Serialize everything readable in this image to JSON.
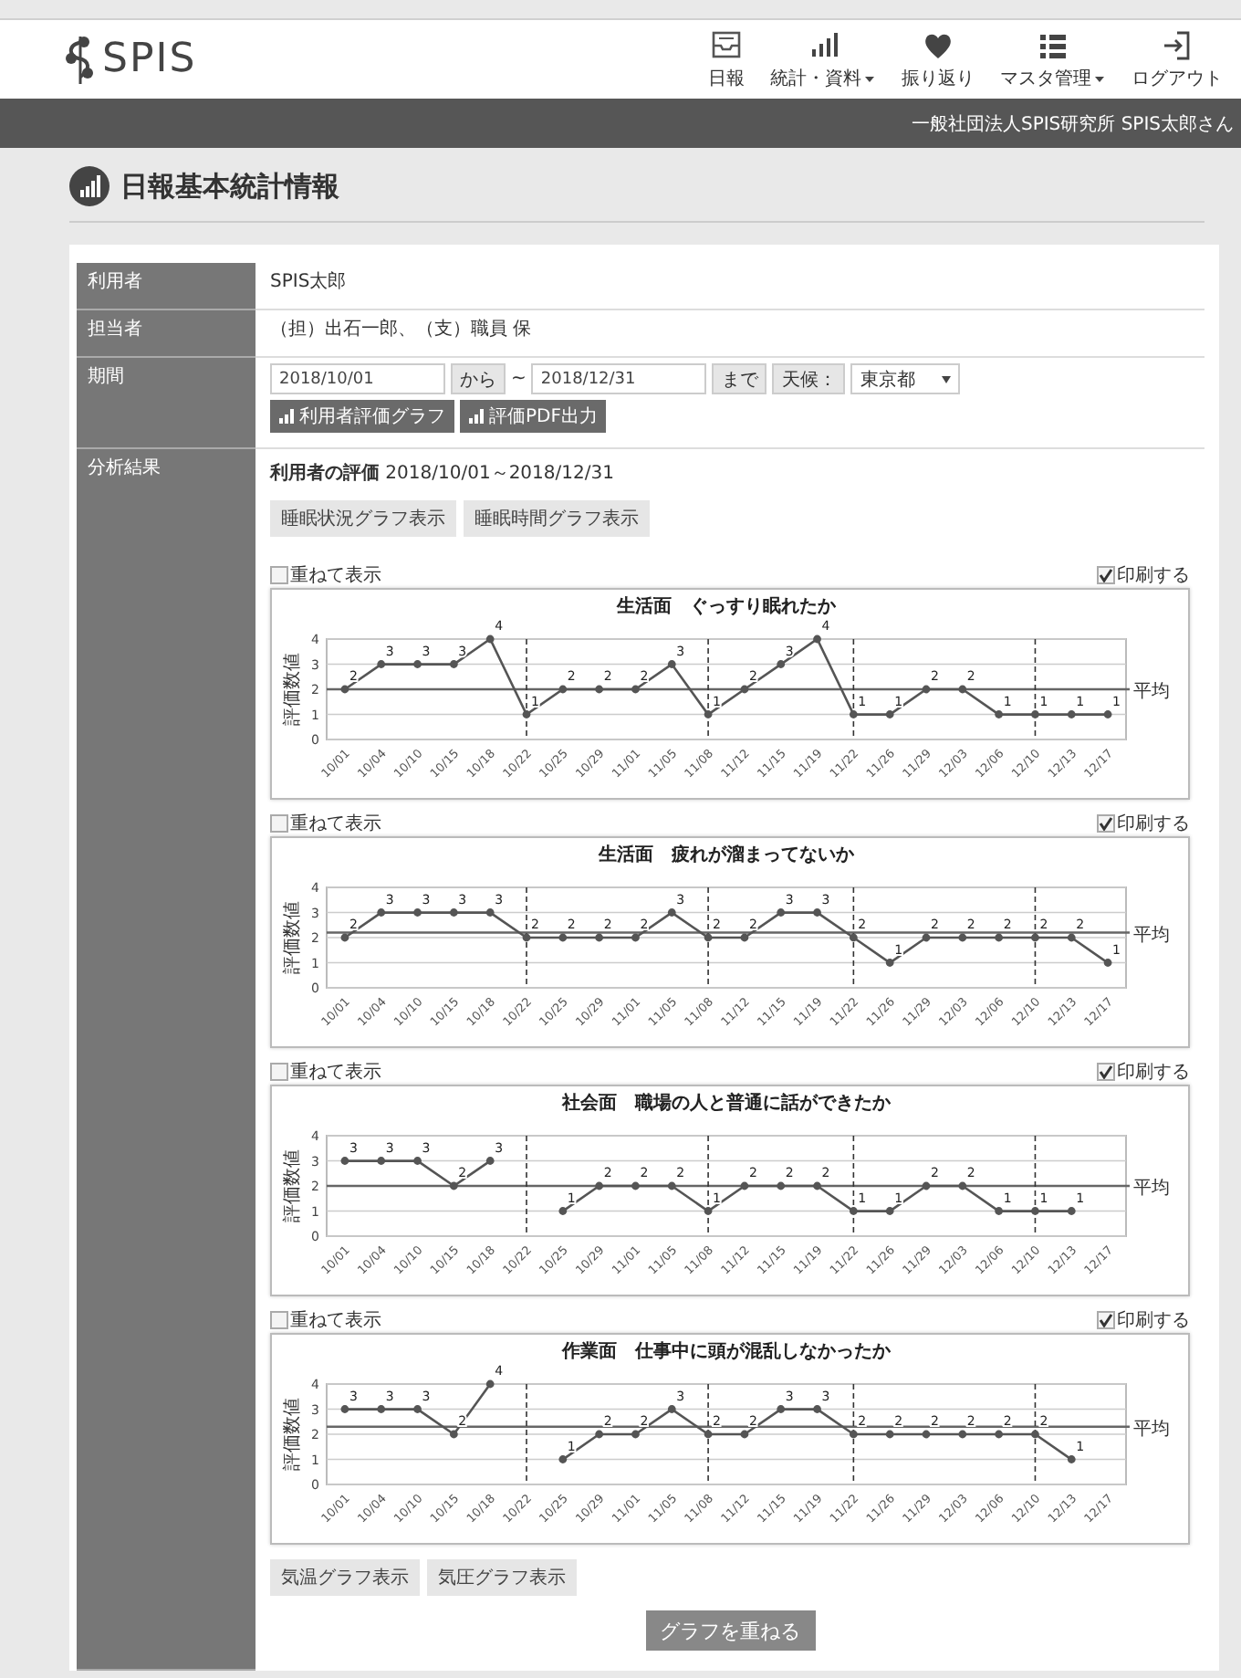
{
  "header": {
    "logo": "SPIS",
    "nav": [
      {
        "label": "日報",
        "has_menu": false
      },
      {
        "label": "統計・資料",
        "has_menu": true
      },
      {
        "label": "振り返り",
        "has_menu": false
      },
      {
        "label": "マスタ管理",
        "has_menu": true
      },
      {
        "label": "ログアウト",
        "has_menu": false
      }
    ]
  },
  "account_bar": {
    "text": "一般社団法人SPIS研究所 SPIS太郎さん"
  },
  "page_title": "日報基本統計情報",
  "info": {
    "user": {
      "label": "利用者",
      "value": "SPIS太郎"
    },
    "staff": {
      "label": "担当者",
      "value": "（担）出石一郎、（支）職員 保"
    },
    "period": {
      "label": "期間",
      "from": "2018/10/01",
      "from_suffix": "から",
      "separator": "~",
      "to": "2018/12/31",
      "to_suffix": "まで",
      "weather_label": "天候：",
      "weather_value": "東京都",
      "buttons": [
        "利用者評価グラフ",
        "評価PDF出力"
      ]
    }
  },
  "results": {
    "label": "分析結果",
    "heading": "**利用者の評価** 2018/10/01～2018/12/31",
    "sleep_buttons": [
      "睡眠状況グラフ表示",
      "睡眠時間グラフ表示"
    ],
    "charts": [
      {
        "overlay": {
          "label": "重ねて表示",
          "checked": false
        },
        "print": {
          "label": "印刷する",
          "checked": true
        },
        "chart_data": {
          "type": "line",
          "title": "生活面　ぐっすり眠れたか",
          "ylabel": "評価数値",
          "categories": [
            "10/01",
            "10/04",
            "10/10",
            "10/15",
            "10/18",
            "10/22",
            "10/25",
            "10/29",
            "11/01",
            "11/05",
            "11/08",
            "11/12",
            "11/15",
            "11/19",
            "11/22",
            "11/26",
            "11/29",
            "12/03",
            "12/06",
            "12/10",
            "12/13",
            "12/17"
          ],
          "series": [
            {
              "color": "#555555",
              "marker": "o",
              "values": [
                2,
                3,
                3,
                3,
                4,
                1,
                2,
                2,
                2,
                3,
                1,
                2,
                3,
                4,
                1,
                1,
                2,
                2,
                1,
                1,
                1,
                1
              ]
            }
          ],
          "ylim": [
            0,
            4
          ],
          "yticks": [
            0,
            1,
            2,
            3,
            4
          ],
          "grid": true,
          "data_labels": true,
          "ref_lines": [
            {
              "axis": "y",
              "value": 2.0,
              "label": "平均"
            },
            {
              "axis": "x",
              "value": "10/22"
            },
            {
              "axis": "x",
              "value": "11/08"
            },
            {
              "axis": "x",
              "value": "11/22"
            },
            {
              "axis": "x",
              "value": "12/10"
            }
          ]
        }
      },
      {
        "overlay": {
          "label": "重ねて表示",
          "checked": false
        },
        "print": {
          "label": "印刷する",
          "checked": true
        },
        "chart_data": {
          "type": "line",
          "title": "生活面　疲れが溜まってないか",
          "ylabel": "評価数値",
          "categories": [
            "10/01",
            "10/04",
            "10/10",
            "10/15",
            "10/18",
            "10/22",
            "10/25",
            "10/29",
            "11/01",
            "11/05",
            "11/08",
            "11/12",
            "11/15",
            "11/19",
            "11/22",
            "11/26",
            "11/29",
            "12/03",
            "12/06",
            "12/10",
            "12/13",
            "12/17"
          ],
          "series": [
            {
              "color": "#555555",
              "marker": "o",
              "values": [
                2,
                3,
                3,
                3,
                3,
                2,
                2,
                2,
                2,
                3,
                2,
                2,
                3,
                3,
                2,
                1,
                2,
                2,
                2,
                2,
                2,
                1
              ]
            }
          ],
          "ylim": [
            0,
            4
          ],
          "yticks": [
            0,
            1,
            2,
            3,
            4
          ],
          "grid": true,
          "data_labels": true,
          "ref_lines": [
            {
              "axis": "y",
              "value": 2.2,
              "label": "平均"
            },
            {
              "axis": "x",
              "value": "10/22"
            },
            {
              "axis": "x",
              "value": "11/08"
            },
            {
              "axis": "x",
              "value": "11/22"
            },
            {
              "axis": "x",
              "value": "12/10"
            }
          ]
        }
      },
      {
        "overlay": {
          "label": "重ねて表示",
          "checked": false
        },
        "print": {
          "label": "印刷する",
          "checked": true
        },
        "chart_data": {
          "type": "line",
          "title": "社会面　職場の人と普通に話ができたか",
          "ylabel": "評価数値",
          "categories": [
            "10/01",
            "10/04",
            "10/10",
            "10/15",
            "10/18",
            "10/22",
            "10/25",
            "10/29",
            "11/01",
            "11/05",
            "11/08",
            "11/12",
            "11/15",
            "11/19",
            "11/22",
            "11/26",
            "11/29",
            "12/03",
            "12/06",
            "12/10",
            "12/13",
            "12/17"
          ],
          "series": [
            {
              "color": "#555555",
              "marker": "o",
              "values": [
                3,
                3,
                3,
                2,
                3,
                null,
                1,
                2,
                2,
                2,
                1,
                2,
                2,
                2,
                1,
                1,
                2,
                2,
                1,
                1,
                1,
                null
              ]
            }
          ],
          "ylim": [
            0,
            4
          ],
          "yticks": [
            0,
            1,
            2,
            3,
            4
          ],
          "grid": true,
          "data_labels": true,
          "ref_lines": [
            {
              "axis": "y",
              "value": 2.0,
              "label": "平均"
            },
            {
              "axis": "x",
              "value": "10/22"
            },
            {
              "axis": "x",
              "value": "11/08"
            },
            {
              "axis": "x",
              "value": "11/22"
            },
            {
              "axis": "x",
              "value": "12/10"
            }
          ]
        }
      },
      {
        "overlay": {
          "label": "重ねて表示",
          "checked": false
        },
        "print": {
          "label": "印刷する",
          "checked": true
        },
        "chart_data": {
          "type": "line",
          "title": "作業面　仕事中に頭が混乱しなかったか",
          "ylabel": "評価数値",
          "categories": [
            "10/01",
            "10/04",
            "10/10",
            "10/15",
            "10/18",
            "10/22",
            "10/25",
            "10/29",
            "11/01",
            "11/05",
            "11/08",
            "11/12",
            "11/15",
            "11/19",
            "11/22",
            "11/26",
            "11/29",
            "12/03",
            "12/06",
            "12/10",
            "12/13",
            "12/17"
          ],
          "series": [
            {
              "color": "#555555",
              "marker": "o",
              "values": [
                3,
                3,
                3,
                2,
                4,
                null,
                1,
                2,
                2,
                3,
                2,
                2,
                3,
                3,
                2,
                2,
                2,
                2,
                2,
                2,
                1,
                null
              ]
            }
          ],
          "ylim": [
            0,
            4
          ],
          "yticks": [
            0,
            1,
            2,
            3,
            4
          ],
          "grid": true,
          "data_labels": true,
          "ref_lines": [
            {
              "axis": "y",
              "value": 2.3,
              "label": "平均"
            },
            {
              "axis": "x",
              "value": "10/22"
            },
            {
              "axis": "x",
              "value": "11/08"
            },
            {
              "axis": "x",
              "value": "11/22"
            },
            {
              "axis": "x",
              "value": "12/10"
            }
          ]
        }
      }
    ],
    "weather_buttons": [
      "気温グラフ表示",
      "気圧グラフ表示"
    ],
    "overlay_button": "グラフを重ねる"
  }
}
